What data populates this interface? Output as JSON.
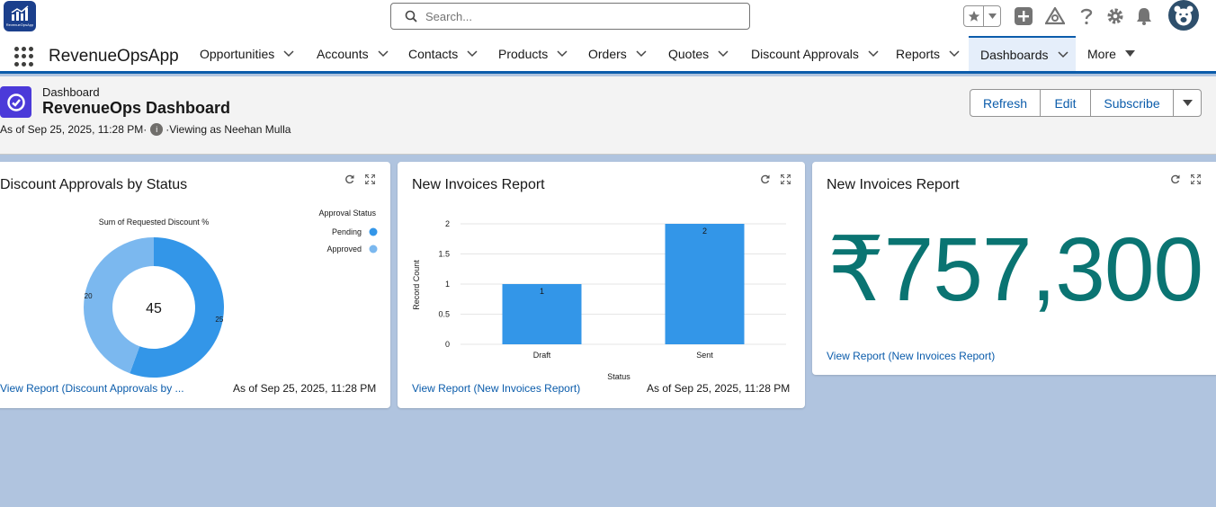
{
  "header": {
    "logo_text": "RevenueOpsApp",
    "search_placeholder": "Search..."
  },
  "nav": {
    "app_name": "RevenueOpsApp",
    "items": [
      {
        "label": "Opportunities"
      },
      {
        "label": "Accounts"
      },
      {
        "label": "Contacts"
      },
      {
        "label": "Products"
      },
      {
        "label": "Orders"
      },
      {
        "label": "Quotes"
      },
      {
        "label": "Discount Approvals"
      },
      {
        "label": "Reports"
      },
      {
        "label": "Dashboards"
      },
      {
        "label": "More"
      }
    ],
    "active": "Dashboards"
  },
  "dashboard": {
    "type_label": "Dashboard",
    "title": "RevenueOps Dashboard",
    "as_of": "As of Sep 25, 2025, 11:28 PM·",
    "viewing_as": "·Viewing as Neehan Mulla",
    "buttons": {
      "refresh": "Refresh",
      "edit": "Edit",
      "subscribe": "Subscribe"
    }
  },
  "cards": [
    {
      "title": "Discount Approvals by Status",
      "link": "View Report (Discount Approvals by ...",
      "as_of": "As of Sep 25, 2025, 11:28 PM"
    },
    {
      "title": "New Invoices Report",
      "link": "View Report (New Invoices Report)",
      "as_of": "As of Sep 25, 2025, 11:28 PM"
    },
    {
      "title": "New Invoices Report",
      "metric": "₹757,300",
      "link": "View Report (New Invoices Report)"
    }
  ],
  "chart_data": [
    {
      "type": "pie",
      "title": "Sum of Requested Discount %",
      "legend_title": "Approval Status",
      "legend_position": "top-right",
      "center_total": "45",
      "categories": [
        "Pending",
        "Approved"
      ],
      "values": [
        25,
        20
      ],
      "colors": [
        "#3396e8",
        "#7bb8ef"
      ]
    },
    {
      "type": "bar",
      "categories": [
        "Draft",
        "Sent"
      ],
      "values": [
        1,
        2
      ],
      "xlabel": "Status",
      "ylabel": "Record Count",
      "ylim": [
        0,
        2
      ],
      "yticks": [
        "0",
        "0.5",
        "1",
        "1.5",
        "2"
      ],
      "grid": true,
      "color": "#3396e8"
    }
  ]
}
